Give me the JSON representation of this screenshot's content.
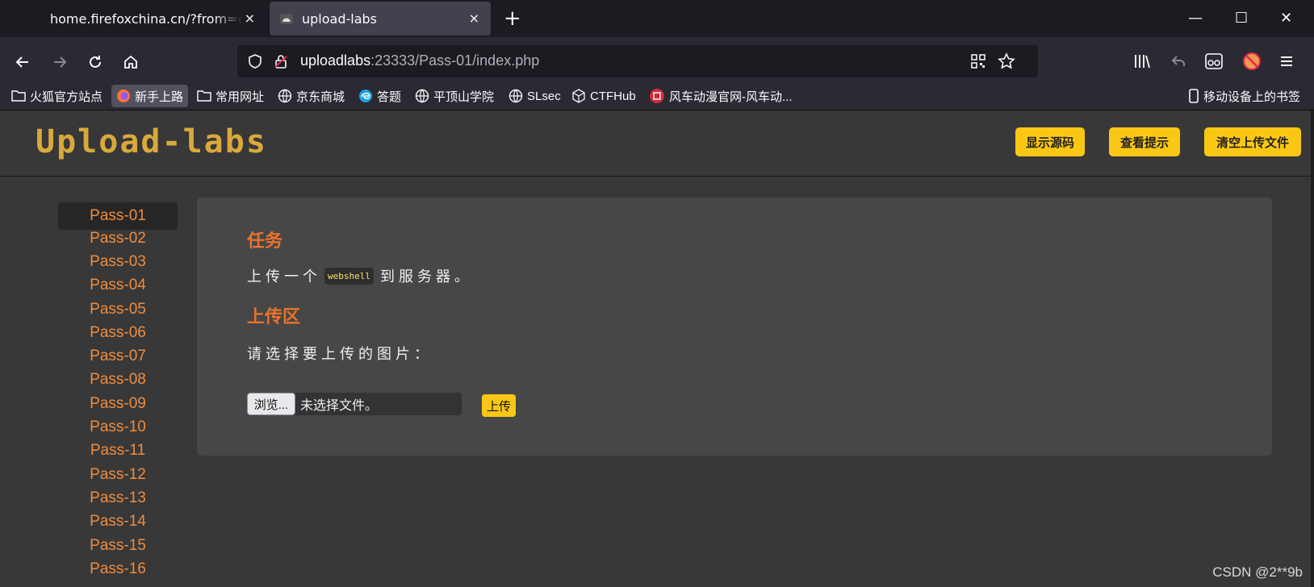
{
  "tabs": [
    {
      "title": "home.firefoxchina.cn/?from=extra_start"
    },
    {
      "title": "upload-labs"
    }
  ],
  "tab_close_glyph": "×",
  "new_tab_glyph": "+",
  "window_controls": {
    "minimize": "—",
    "maximize": "☐",
    "close": "✕"
  },
  "urlbar": {
    "host": "uploadlabs",
    "rest": ":23333/Pass-01/index.php"
  },
  "bookmarks": [
    {
      "label": "火狐官方站点",
      "icon": "folder-icon"
    },
    {
      "label": "新手上路",
      "icon": "firefox-icon"
    },
    {
      "label": "常用网址",
      "icon": "folder-icon"
    },
    {
      "label": "京东商城",
      "icon": "globe-icon"
    },
    {
      "label": "答题",
      "icon": "edge-icon"
    },
    {
      "label": "平顶山学院",
      "icon": "globe-icon"
    },
    {
      "label": "SLsec",
      "icon": "globe-icon"
    },
    {
      "label": "CTFHub",
      "icon": "cube-icon"
    },
    {
      "label": "风车动漫官网-风车动...",
      "icon": "anime-icon"
    }
  ],
  "mobile_bookmarks": "移动设备上的书签",
  "site": {
    "logo": "Upload-labs",
    "buttons": {
      "show_source": "显示源码",
      "view_hint": "查看提示",
      "clear_uploads": "清空上传文件"
    }
  },
  "passes": [
    "Pass-01",
    "Pass-02",
    "Pass-03",
    "Pass-04",
    "Pass-05",
    "Pass-06",
    "Pass-07",
    "Pass-08",
    "Pass-09",
    "Pass-10",
    "Pass-11",
    "Pass-12",
    "Pass-13",
    "Pass-14",
    "Pass-15",
    "Pass-16"
  ],
  "content": {
    "task_title": "任务",
    "task_before": "上传一个",
    "task_code": "webshell",
    "task_after": "到服务器。",
    "upload_title": "上传区",
    "choose_label": "请选择要上传的图片：",
    "browse_label": "浏览...",
    "no_file": "未选择文件。",
    "upload_button": "上传"
  },
  "watermark": "CSDN @2**9b",
  "colors": {
    "accent": "#fac814",
    "pass_link": "#f08c3e",
    "section_title": "#e8732a"
  }
}
